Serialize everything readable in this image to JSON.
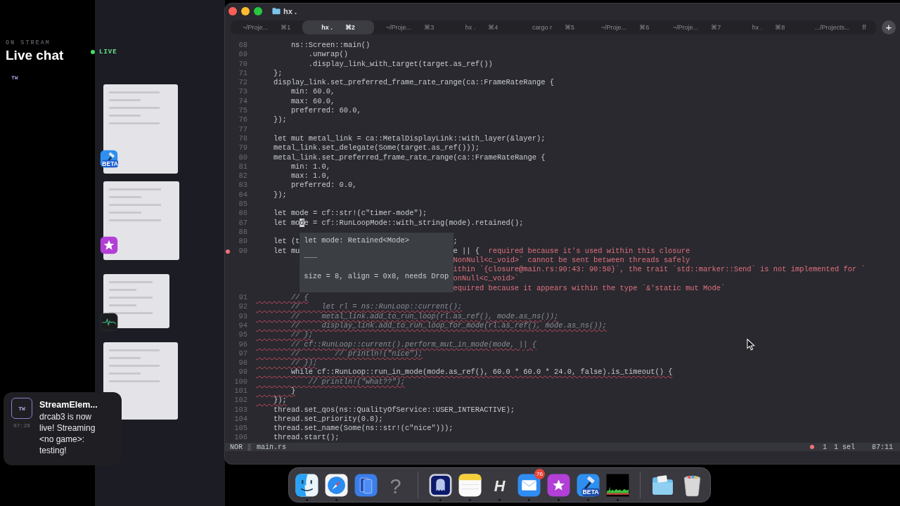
{
  "stream_panel": {
    "eyebrow": "ON STREAM",
    "title": "Live chat",
    "badge": "TW",
    "live_label": "LIVE"
  },
  "stage_windows": [
    {
      "kind": "xcode",
      "icon_label": "BETA"
    },
    {
      "kind": "star"
    },
    {
      "kind": "activity"
    },
    {
      "kind": "plain"
    }
  ],
  "notification": {
    "badge": "TW",
    "time": "07:26",
    "title": "StreamElem...",
    "body": "drcab3 is now live! Streaming <no game>: testing!"
  },
  "window": {
    "title": "hx .",
    "tabs": [
      {
        "label": "~/Proje...",
        "shortcut": "⌘1",
        "selected": false
      },
      {
        "label": "hx .",
        "shortcut": "⌘2",
        "selected": true
      },
      {
        "label": "~/Proje...",
        "shortcut": "⌘3",
        "selected": false
      },
      {
        "label": "hx .",
        "shortcut": "⌘4",
        "selected": false
      },
      {
        "label": "cargo r",
        "shortcut": "⌘5",
        "selected": false
      },
      {
        "label": "~/Proje...",
        "shortcut": "⌘6",
        "selected": false
      },
      {
        "label": "~/Proje...",
        "shortcut": "⌘7",
        "selected": false
      },
      {
        "label": "hx .",
        "shortcut": "⌘8",
        "selected": false
      },
      {
        "label": ".../Projects...",
        "shortcut": "ff",
        "selected": false
      }
    ],
    "new_tab": "+"
  },
  "editor": {
    "lines": [
      {
        "number": "68",
        "kind": "code",
        "code": "        ns::Screen::main()"
      },
      {
        "number": "69",
        "kind": "code",
        "code": "            .unwrap()"
      },
      {
        "number": "70",
        "kind": "code",
        "code": "            .display_link_with_target(target.as_ref())"
      },
      {
        "number": "71",
        "kind": "code",
        "code": "    };"
      },
      {
        "number": "72",
        "kind": "code",
        "code": "    display_link.set_preferred_frame_rate_range(ca::FrameRateRange {"
      },
      {
        "number": "73",
        "kind": "code",
        "code": "        min: 60.0,"
      },
      {
        "number": "74",
        "kind": "code",
        "code": "        max: 60.0,"
      },
      {
        "number": "75",
        "kind": "code",
        "code": "        preferred: 60.0,"
      },
      {
        "number": "76",
        "kind": "code",
        "code": "    });"
      },
      {
        "number": "77",
        "kind": "code"
      },
      {
        "number": "78",
        "kind": "code",
        "code": "    let mut metal_link = ca::MetalDisplayLink::with_layer(&layer);"
      },
      {
        "number": "79",
        "kind": "code",
        "code": "    metal_link.set_delegate(Some(target.as_ref()));"
      },
      {
        "number": "80",
        "kind": "code",
        "code": "    metal_link.set_preferred_frame_rate_range(ca::FrameRateRange {"
      },
      {
        "number": "81",
        "kind": "code",
        "code": "        min: 1.0,"
      },
      {
        "number": "82",
        "kind": "code",
        "code": "        max: 1.0,"
      },
      {
        "number": "83",
        "kind": "code",
        "code": "        preferred: 0.0,"
      },
      {
        "number": "84",
        "kind": "code",
        "code": "    });"
      },
      {
        "number": "85",
        "kind": "code"
      },
      {
        "number": "86",
        "kind": "code",
        "code": "    let mode = cf::str!(c\"timer-mode\");"
      },
      {
        "number": "87",
        "kind": "code",
        "code": "    let mo",
        "cursor": "d",
        "code_cont": "e = cf::RunLoopMode::with_string(mode).retained();"
      },
      {
        "number": "88",
        "kind": "code"
      },
      {
        "number": "89",
        "kind": "code",
        "code": "    let (t",
        "after_popup": ";"
      },
      {
        "number": "90",
        "kind": "error",
        "code": "    let mu",
        "after_popup": "e || {",
        "diagnostic": "required because it's used within this closure"
      },
      {
        "kind": "diagnostic",
        "diagnostic": "NonNull<c_void>` cannot be sent between threads safely"
      },
      {
        "kind": "diagnostic",
        "diagnostic": "ithin `{closure@main.rs:90:43: 90:50}`, the trait `std::marker::Send` is not implemented for `"
      },
      {
        "kind": "diagnostic",
        "diagnostic": "onNull<c_void>`"
      },
      {
        "kind": "diagnostic",
        "diagnostic": "equired because it appears within the type `&'static mut Mode`"
      },
      {
        "number": "91",
        "kind": "squiggled_comment",
        "code": "        // {"
      },
      {
        "number": "92",
        "kind": "squiggled_comment",
        "code": "        //     let rl = ns::RunLoop::current();"
      },
      {
        "number": "93",
        "kind": "squiggled_comment",
        "code": "        //     metal_link.add_to_run_loop(rl.as_ref(), mode.as_ns());"
      },
      {
        "number": "94",
        "kind": "squiggled_comment",
        "code": "        //     display_link.add_to_run_loop_for_mode(rl.as_ref(), mode.as_ns());"
      },
      {
        "number": "95",
        "kind": "squiggled_comment",
        "code": "        // };"
      },
      {
        "number": "96",
        "kind": "squiggled_comment",
        "code": "        // cf::RunLoop::current().perform_mut_in_mode(mode, || {"
      },
      {
        "number": "97",
        "kind": "squiggled_comment",
        "code": "        //        // println!(\"nice\");"
      },
      {
        "number": "98",
        "kind": "squiggled_comment",
        "code": "        // });"
      },
      {
        "number": "99",
        "kind": "squiggled",
        "code": "        while cf::RunLoop::run_in_mode(mode.as_ref(), 60.0 * 60.0 * 24.0, false).is_timeout() {"
      },
      {
        "number": "100",
        "kind": "squiggled_comment",
        "code": "            // println!(\"what??\");"
      },
      {
        "number": "101",
        "kind": "squiggled",
        "code": "        }"
      },
      {
        "number": "102",
        "kind": "squiggled",
        "code": "    });"
      },
      {
        "number": "103",
        "kind": "code",
        "code": "    thread.set_qos(ns::QualityOfService::USER_INTERACTIVE);"
      },
      {
        "number": "104",
        "kind": "code",
        "code": "    thread.set_priority(0.8);"
      },
      {
        "number": "105",
        "kind": "code",
        "code": "    thread.set_name(Some(ns::str!(c\"nice\")));"
      },
      {
        "number": "106",
        "kind": "code",
        "code": "    thread.start();"
      }
    ],
    "hover": {
      "signature": "let mode: Retained<Mode>",
      "divider": "───",
      "details": "size = 8, align = 0x8, needs Drop"
    }
  },
  "status_bar": {
    "mode": "NOR",
    "file": "main.rs",
    "errors": "1",
    "selections": "1 sel",
    "position": "87:11"
  },
  "dock": {
    "groups": [
      [
        {
          "kind": "finder",
          "running": true
        },
        {
          "kind": "safari",
          "running": true
        },
        {
          "kind": "windows",
          "running": false
        },
        {
          "kind": "unknown",
          "glyph": "?",
          "running": false
        }
      ],
      [
        {
          "kind": "ghost",
          "running": true
        },
        {
          "kind": "notes",
          "running": true
        },
        {
          "kind": "letter",
          "glyph": "H",
          "running": true
        },
        {
          "kind": "mail",
          "badge": "76",
          "running": true
        },
        {
          "kind": "star",
          "running": true
        },
        {
          "kind": "xcode",
          "label": "BETA",
          "running": true
        },
        {
          "kind": "activity",
          "running": true
        }
      ],
      [
        {
          "kind": "folder",
          "running": false
        },
        {
          "kind": "trash",
          "running": false
        }
      ]
    ]
  }
}
